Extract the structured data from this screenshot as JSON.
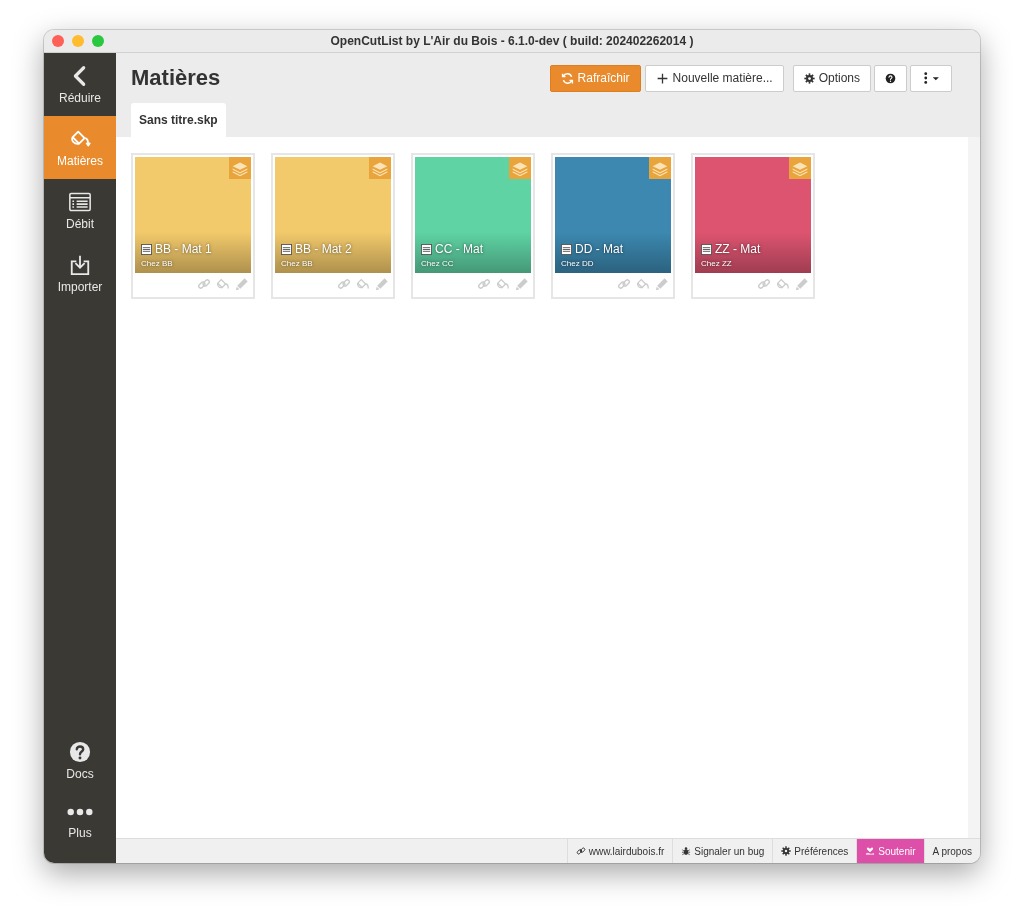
{
  "window": {
    "title": "OpenCutList by L'Air du Bois - 6.1.0-dev ( build: 202402262014 )"
  },
  "sidebar": {
    "items": [
      {
        "label": "Réduire",
        "selected": false
      },
      {
        "label": "Matières",
        "selected": true
      },
      {
        "label": "Débit",
        "selected": false
      },
      {
        "label": "Importer",
        "selected": false
      }
    ],
    "bottom_items": [
      {
        "label": "Docs"
      },
      {
        "label": "Plus"
      }
    ]
  },
  "header": {
    "title": "Matières",
    "buttons": [
      {
        "label": "Rafraîchir",
        "kind": "primary"
      },
      {
        "label": "Nouvelle matière...",
        "kind": "default"
      },
      {
        "label": "Options",
        "kind": "default"
      },
      {
        "kind": "icon"
      },
      {
        "kind": "icon"
      }
    ]
  },
  "tabs": [
    {
      "label": "Sans titre.skp",
      "selected": true
    }
  ],
  "materials": [
    {
      "name": "BB - Mat 1",
      "owner": "Chez BB",
      "color": "#f2c96b"
    },
    {
      "name": "BB - Mat 2",
      "owner": "Chez BB",
      "color": "#f2c96b"
    },
    {
      "name": "CC - Mat",
      "owner": "Chez CC",
      "color": "#5fd3a4"
    },
    {
      "name": "DD - Mat",
      "owner": "Chez DD",
      "color": "#3c88b0"
    },
    {
      "name": "ZZ - Mat",
      "owner": "Chez ZZ",
      "color": "#dd5470"
    }
  ],
  "footer": [
    {
      "label": "www.lairdubois.fr",
      "kind": "link"
    },
    {
      "label": "Signaler un bug",
      "kind": "link"
    },
    {
      "label": "Préférences",
      "kind": "link"
    },
    {
      "label": "Soutenir",
      "kind": "highlight"
    },
    {
      "label": "A propos",
      "kind": "link"
    }
  ]
}
